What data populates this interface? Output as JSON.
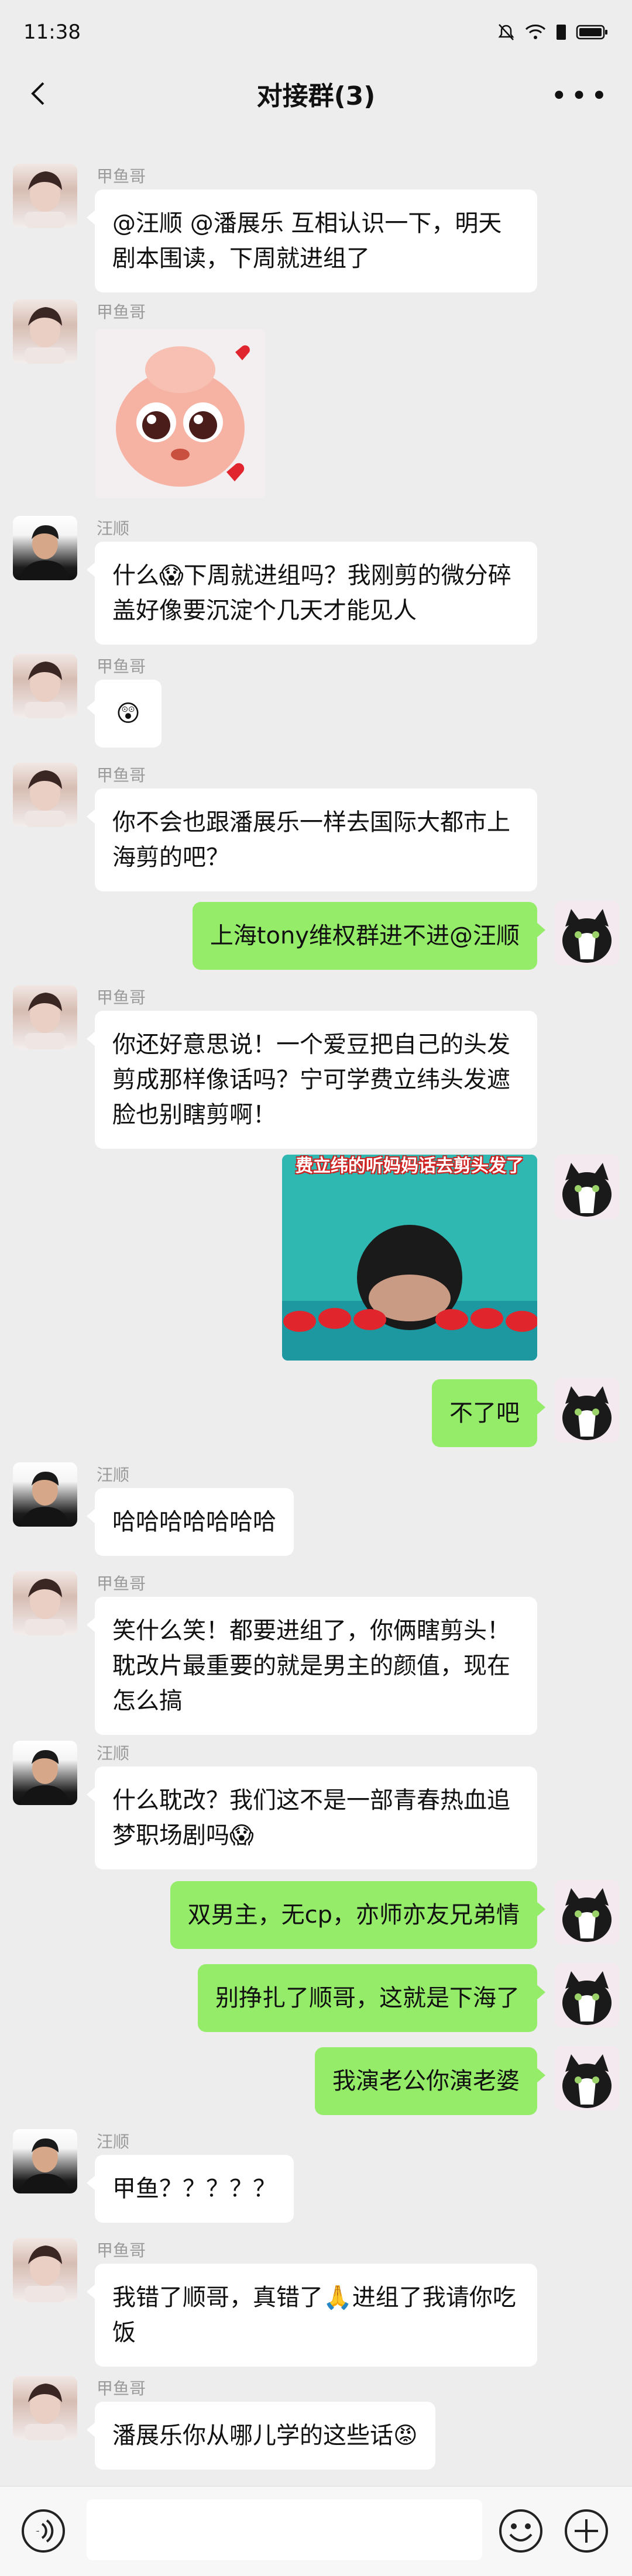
{
  "status_bar": {
    "time": "11:38"
  },
  "header": {
    "title": "对接群(3)"
  },
  "messages": [
    {
      "sender": "甲鱼哥",
      "text": "@汪顺 @潘展乐 互相认识一下，明天剧本围读，下周就进组了"
    },
    {
      "sender": "甲鱼哥",
      "sticker": "pink-creature-sticker"
    },
    {
      "sender": "汪顺",
      "text": "什么😱下周就进组吗？我刚剪的微分碎盖好像要沉淀个几天才能见人"
    },
    {
      "sender": "甲鱼哥",
      "text": "😲"
    },
    {
      "sender": "甲鱼哥",
      "text": "你不会也跟潘展乐一样去国际大都市上海剪的吧？"
    },
    {
      "sender": "me",
      "text": "上海tony维权群进不进@汪顺"
    },
    {
      "sender": "甲鱼哥",
      "text": "你还好意思说！一个爱豆把自己的头发剪成那样像话吗？宁可学费立纬头发遮脸也别瞎剪啊！"
    },
    {
      "sender": "me",
      "sticker": "swimmer-meme",
      "caption": "费立纬的听妈妈话去剪头发了"
    },
    {
      "sender": "me",
      "text": "不了吧"
    },
    {
      "sender": "汪顺",
      "text": "哈哈哈哈哈哈哈"
    },
    {
      "sender": "甲鱼哥",
      "text": "笑什么笑！都要进组了，你俩瞎剪头！耽改片最重要的就是男主的颜值，现在怎么搞"
    },
    {
      "sender": "汪顺",
      "text": "什么耽改？我们这不是一部青春热血追梦职场剧吗😱"
    },
    {
      "sender": "me",
      "text": "双男主，无cp，亦师亦友兄弟情"
    },
    {
      "sender": "me",
      "text": "别挣扎了顺哥，这就是下海了"
    },
    {
      "sender": "me",
      "text": "我演老公你演老婆"
    },
    {
      "sender": "汪顺",
      "text": "甲鱼？？？？？"
    },
    {
      "sender": "甲鱼哥",
      "text": "我错了顺哥，真错了🙏进组了我请你吃饭"
    },
    {
      "sender": "甲鱼哥",
      "text": "潘展乐你从哪儿学的这些话😡"
    }
  ],
  "input_bar": {
    "placeholder": ""
  },
  "colors": {
    "background": "#ededed",
    "incoming": "#ffffff",
    "outgoing": "#95ec69"
  }
}
